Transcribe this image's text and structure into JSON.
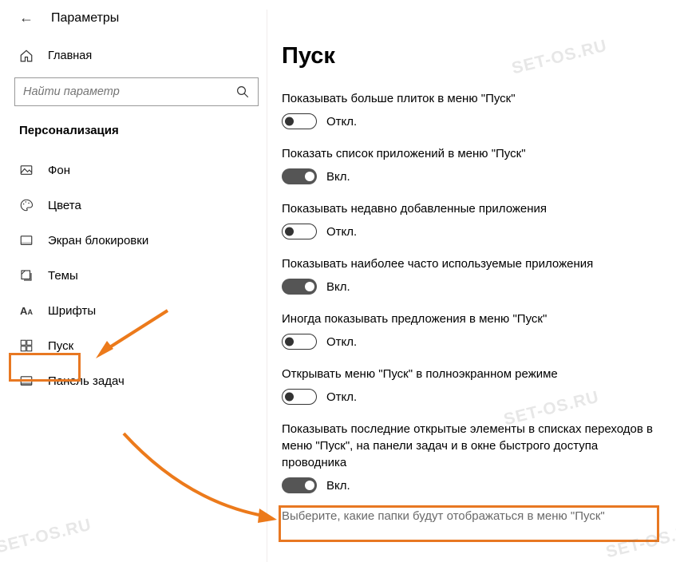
{
  "header": {
    "app_title": "Параметры",
    "home_label": "Главная",
    "search_placeholder": "Найти параметр",
    "section_title": "Персонализация"
  },
  "sidebar": {
    "items": [
      {
        "label": "Фон"
      },
      {
        "label": "Цвета"
      },
      {
        "label": "Экран блокировки"
      },
      {
        "label": "Темы"
      },
      {
        "label": "Шрифты"
      },
      {
        "label": "Пуск"
      },
      {
        "label": "Панель задач"
      }
    ]
  },
  "page": {
    "title": "Пуск",
    "settings": [
      {
        "label": "Показывать больше плиток в меню \"Пуск\"",
        "state": "off",
        "state_text": "Откл."
      },
      {
        "label": "Показать список приложений в меню \"Пуск\"",
        "state": "on",
        "state_text": "Вкл."
      },
      {
        "label": "Показывать недавно добавленные приложения",
        "state": "off",
        "state_text": "Откл."
      },
      {
        "label": "Показывать наиболее часто используемые приложения",
        "state": "on",
        "state_text": "Вкл."
      },
      {
        "label": "Иногда показывать предложения в меню \"Пуск\"",
        "state": "off",
        "state_text": "Откл."
      },
      {
        "label": "Открывать меню \"Пуск\" в полноэкранном режиме",
        "state": "off",
        "state_text": "Откл."
      },
      {
        "label": "Показывать последние открытые элементы в списках переходов в меню \"Пуск\", на панели задач и в окне быстрого доступа проводника",
        "state": "on",
        "state_text": "Вкл."
      }
    ],
    "link": "Выберите, какие папки будут отображаться в меню \"Пуск\""
  },
  "watermark": "SET-OS.RU"
}
